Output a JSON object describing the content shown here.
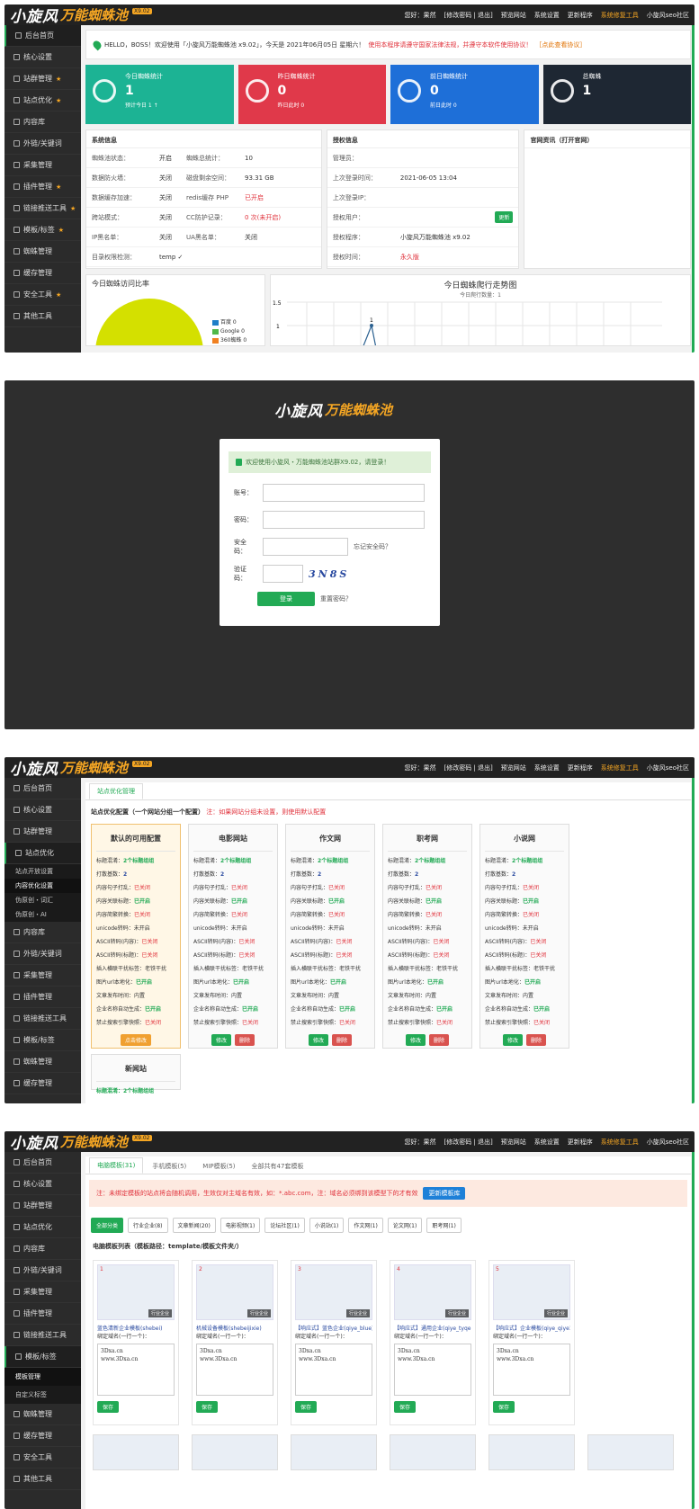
{
  "brand": {
    "name": "小旋风",
    "sub": "万能蜘蛛池",
    "ver": "X9.02"
  },
  "topnav": [
    "您好：果然",
    "[修改密码 | 退出]",
    "预览网站",
    "系统设置",
    "更新程序",
    "系统修复工具",
    "小旋风seo社区"
  ],
  "side1": [
    {
      "l": "后台首页",
      "s": false
    },
    {
      "l": "核心设置",
      "s": false
    },
    {
      "l": "站群管理",
      "s": true
    },
    {
      "l": "站点优化",
      "s": true
    },
    {
      "l": "内容库",
      "s": false
    },
    {
      "l": "外链/关键词",
      "s": false
    },
    {
      "l": "采集管理",
      "s": false
    },
    {
      "l": "插件管理",
      "s": true
    },
    {
      "l": "链接推送工具",
      "s": true
    },
    {
      "l": "模板/标签",
      "s": true
    },
    {
      "l": "蜘蛛管理",
      "s": false
    },
    {
      "l": "缓存管理",
      "s": false
    },
    {
      "l": "安全工具",
      "s": true
    },
    {
      "l": "其他工具",
      "s": false
    }
  ],
  "welcome": {
    "a": "HELLO，BOSS！欢迎使用「小旋风万能蜘蛛池 x9.02」，今天是 2021年06月05日 星期六！",
    "b": "使用本程序请遵守国家法律法规，并遵守本软件使用协议！",
    "c": "［点此查看协议］"
  },
  "stats": [
    {
      "label": "今日蜘蛛统计",
      "num": "1",
      "sub": "预计今日 1 ↑",
      "color": "#1cb394"
    },
    {
      "label": "昨日蜘蛛统计",
      "num": "0",
      "sub": "昨日此时 0",
      "color": "#e0394a"
    },
    {
      "label": "前日蜘蛛统计",
      "num": "0",
      "sub": "前日此时 0",
      "color": "#1e6fd8"
    },
    {
      "label": "总蜘蛛",
      "num": "1",
      "sub": "",
      "color": "#1e2733"
    }
  ],
  "sys": {
    "title": "系统信息",
    "rows": [
      [
        "蜘蛛池状态：",
        "开启",
        "蜘蛛总统计：",
        "10"
      ],
      [
        "数据防火墙：",
        "关闭",
        "磁盘剩余空间：",
        "93.31 GB"
      ],
      [
        "数据缓存加速：",
        "关闭",
        "redis缓存 PHP",
        "已开启"
      ],
      [
        "跨站模式：",
        "关闭",
        "CC防护记录：",
        "0 次(未开启)"
      ],
      [
        "IP黑名单：",
        "关闭",
        "UA黑名单：",
        "关闭"
      ],
      [
        "目录权限检测：",
        "temp ✓",
        "",
        ""
      ]
    ]
  },
  "auth": {
    "title": "授权信息",
    "rows": [
      [
        "管理员：",
        "",
        ""
      ],
      [
        "上次登录时间：",
        "2021-06-05 13:04",
        ""
      ],
      [
        "上次登录IP：",
        "",
        ""
      ],
      [
        "授权用户：",
        "",
        "更新"
      ],
      [
        "授权程序：",
        "小旋风万能蜘蛛池 x9.02",
        ""
      ],
      [
        "授权时间：",
        "永久版",
        ""
      ]
    ]
  },
  "news": {
    "title": "官网资讯（打开官网）"
  },
  "pie": {
    "title": "今日蜘蛛访问比率",
    "legend": [
      {
        "n": "百度 0",
        "c": "#1e7ec8"
      },
      {
        "n": "Google 0",
        "c": "#50b848"
      },
      {
        "n": "360蜘蛛 0",
        "c": "#f08020"
      }
    ]
  },
  "linechart": {
    "title": "今日蜘蛛爬行走势图",
    "subtitle": "今日爬行数量：1",
    "chart_data": {
      "type": "line",
      "yticks": [
        "1.5",
        "1"
      ],
      "values": [
        1
      ]
    }
  },
  "login": {
    "alert": "欢迎使用小旋风・万能蜘蛛池站群X9.02，请登录！",
    "user": "账号：",
    "pass": "密码：",
    "safe": "安全码：",
    "safehint": "忘记安全码？",
    "code": "验证码：",
    "captcha": "3N8S",
    "btn": "登录",
    "forgot": "重置密码？"
  },
  "side3": [
    "后台首页",
    "核心设置",
    "站群管理",
    "站点优化",
    "站点开放设置",
    "内容优化设置",
    "伪原创・词汇",
    "伪原创・AI",
    "内容库",
    "外链/关键词",
    "采集管理",
    "插件管理",
    "链接推送工具",
    "模板/标签",
    "蜘蛛管理",
    "缓存管理"
  ],
  "opt": {
    "tab": "站点优化管理",
    "title": "站点优化配置（一个网站分组一个配置）",
    "note": "注：如果网站分组未设置，则使用默认配置",
    "cards": [
      {
        "t": "默认的可用配置",
        "hl": true,
        "btn": "点击修改"
      },
      {
        "t": "电影网站"
      },
      {
        "t": "作文网"
      },
      {
        "t": "职考网"
      },
      {
        "t": "小说网"
      }
    ],
    "rows": [
      [
        "标题混淆：",
        "2个标题组组",
        "on"
      ],
      [
        "打散基数：",
        "2",
        "bl"
      ],
      [
        "内容句子打乱：",
        "已关闭",
        "off"
      ],
      [
        "内容关联标题：",
        "已开启",
        "on"
      ],
      [
        "内容简繁转换：",
        "已关闭",
        "off"
      ],
      [
        "unicode转码：",
        "未开启",
        ""
      ],
      [
        "ASCII转码(内容)：",
        "已关闭",
        "off"
      ],
      [
        "ASCII转码(标题)：",
        "已关闭",
        "off"
      ],
      [
        "插入横联干扰标签：",
        "老铁干扰",
        ""
      ],
      [
        "图片url本地化：",
        "已开启",
        "on"
      ],
      [
        "文章发布时间：",
        "内置",
        ""
      ],
      [
        "企业名称自动生成：",
        "已开启",
        "on"
      ],
      [
        "禁止搜索引擎快照：",
        "已关闭",
        "off"
      ]
    ],
    "edit": "修改",
    "del": "删除",
    "last": "新闻站",
    "lastrow": "标题混淆：2个标题组组"
  },
  "side4": [
    "后台首页",
    "核心设置",
    "站群管理",
    "站点优化",
    "内容库",
    "外链/关键词",
    "采集管理",
    "插件管理",
    "链接推送工具",
    "模板/标签",
    "模板管理",
    "自定义标签",
    "蜘蛛管理",
    "缓存管理",
    "安全工具",
    "其他工具"
  ],
  "tpl": {
    "tabs": [
      "电脑模板(31)",
      "手机模板(5)",
      "MIP模板(5)",
      "全部共有47套模板"
    ],
    "note": "注：未绑定模板的站点将会随机调用，生效仅对主域名有效，如：*.abc.com，注：域名必须绑到该模型下的才有效",
    "notebtn": "更新模板库",
    "filters": [
      "全部分类",
      "行业企业(8)",
      "文章新闻(20)",
      "电影视频(1)",
      "论坛社区(1)",
      "小说站(1)",
      "作文网(1)",
      "论文网(1)",
      "职考网(1)"
    ],
    "listtitle": "电脑模板列表（模板路径：template/模板文件夹/）",
    "items": [
      {
        "no": "1",
        "tag": "行业企业",
        "name": "蓝色清新企业模板(shebei)"
      },
      {
        "no": "2",
        "tag": "行业企业",
        "name": "机械设备模板(shebeijixie)"
      },
      {
        "no": "3",
        "tag": "行业企业",
        "name": "【响应式】蓝色企业(qiye_blue)"
      },
      {
        "no": "4",
        "tag": "行业企业",
        "name": "【响应式】通用企业(qiye_tyqe)"
      },
      {
        "no": "5",
        "tag": "行业企业",
        "name": "【响应式】企业模板(qiye_qiye1)"
      }
    ],
    "bind": "绑定域名(一行一个)：",
    "domains": "3Dxa.cn\nwww.3Dxa.cn",
    "save": "保存"
  }
}
